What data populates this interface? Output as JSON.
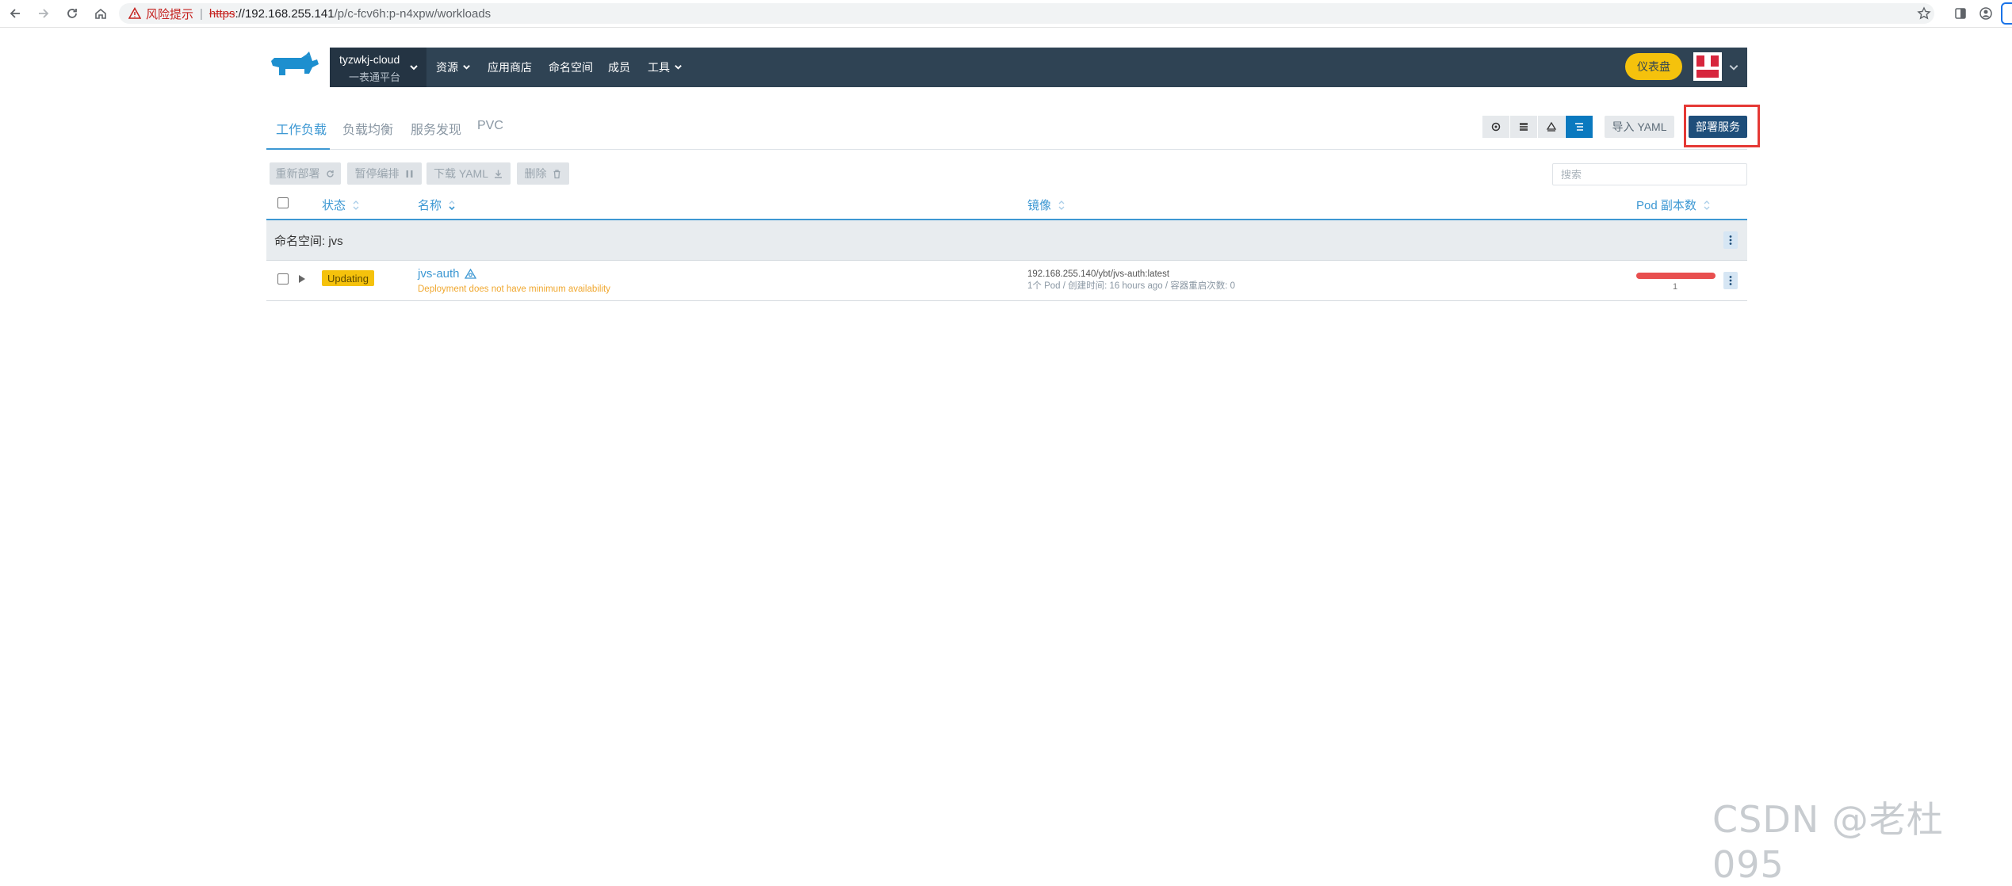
{
  "browser": {
    "security_warning": "风险提示",
    "url_scheme": "https",
    "url_host": "://192.168.255.141",
    "url_path": "/p/c-fcv6h:p-n4xpw/workloads"
  },
  "header": {
    "cluster_name": "tyzwkj-cloud",
    "project_name": "一表通平台",
    "nav": [
      "资源",
      "应用商店",
      "命名空间",
      "成员",
      "工具"
    ],
    "dashboard_label": "仪表盘"
  },
  "tabs": [
    "工作负载",
    "负载均衡",
    "服务发现",
    "PVC"
  ],
  "toolbar": {
    "import_yaml": "导入 YAML",
    "deploy": "部署服务"
  },
  "actions": {
    "redeploy": "重新部署",
    "pause": "暂停编排",
    "download_yaml": "下载 YAML",
    "delete": "删除"
  },
  "search": {
    "placeholder": "搜索"
  },
  "table": {
    "columns": {
      "status": "状态",
      "name": "名称",
      "image": "镜像",
      "pods": "Pod 副本数"
    },
    "group_label": "命名空间: jvs",
    "rows": [
      {
        "status": "Updating",
        "name": "jvs-auth",
        "message": "Deployment does not have minimum availability",
        "image": "192.168.255.140/ybt/jvs-auth:latest",
        "meta": "1个 Pod / 创建时间: 16 hours ago / 容器重启次数: 0",
        "pod_count": "1"
      }
    ]
  },
  "watermark": "CSDN @老杜095",
  "colors": {
    "header_bg": "#2f4354",
    "accent": "#3d98d3",
    "deploy_bg": "#1e4e7a",
    "updating": "#f5c20c",
    "pod_bar": "#e84f4f",
    "highlight": "#e53935"
  }
}
